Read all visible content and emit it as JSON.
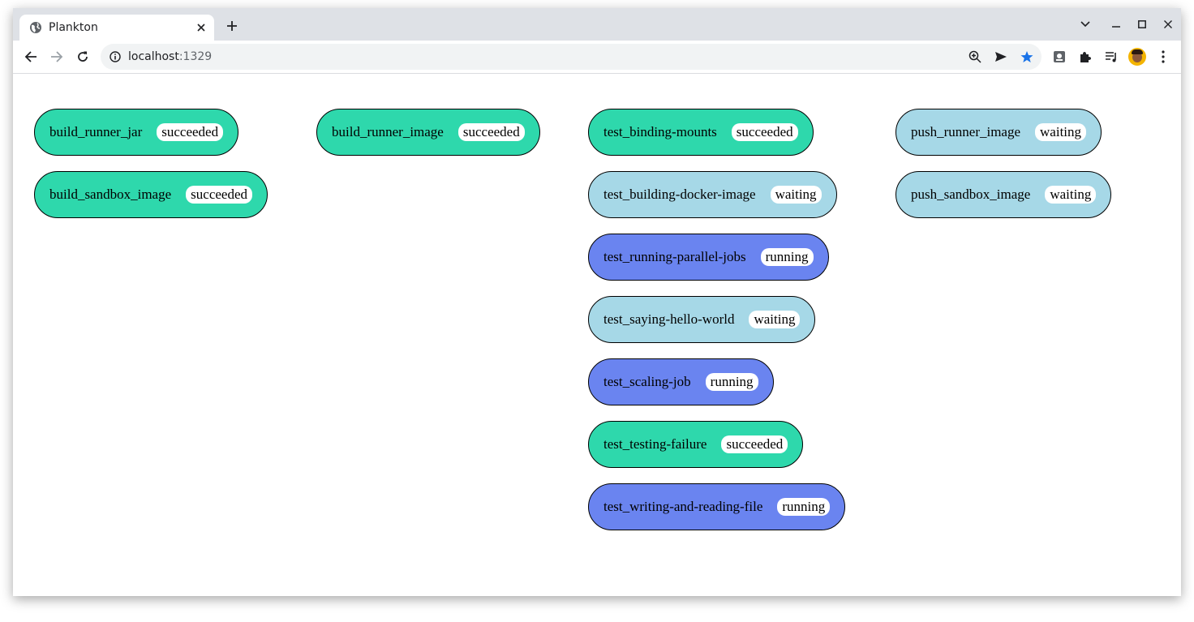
{
  "browser": {
    "tab_title": "Plankton",
    "url_host": "localhost",
    "url_port": ":1329"
  },
  "status_colors": {
    "succeeded": "#2ed8ac",
    "waiting": "#a6d8e7",
    "running": "#6a84f0"
  },
  "columns": [
    {
      "jobs": [
        {
          "name": "build_runner_jar",
          "status": "succeeded"
        },
        {
          "name": "build_sandbox_image",
          "status": "succeeded"
        }
      ]
    },
    {
      "jobs": [
        {
          "name": "build_runner_image",
          "status": "succeeded"
        }
      ]
    },
    {
      "jobs": [
        {
          "name": "test_binding-mounts",
          "status": "succeeded"
        },
        {
          "name": "test_building-docker-image",
          "status": "waiting"
        },
        {
          "name": "test_running-parallel-jobs",
          "status": "running"
        },
        {
          "name": "test_saying-hello-world",
          "status": "waiting"
        },
        {
          "name": "test_scaling-job",
          "status": "running"
        },
        {
          "name": "test_testing-failure",
          "status": "succeeded"
        },
        {
          "name": "test_writing-and-reading-file",
          "status": "running"
        }
      ]
    },
    {
      "jobs": [
        {
          "name": "push_runner_image",
          "status": "waiting"
        },
        {
          "name": "push_sandbox_image",
          "status": "waiting"
        }
      ]
    }
  ]
}
